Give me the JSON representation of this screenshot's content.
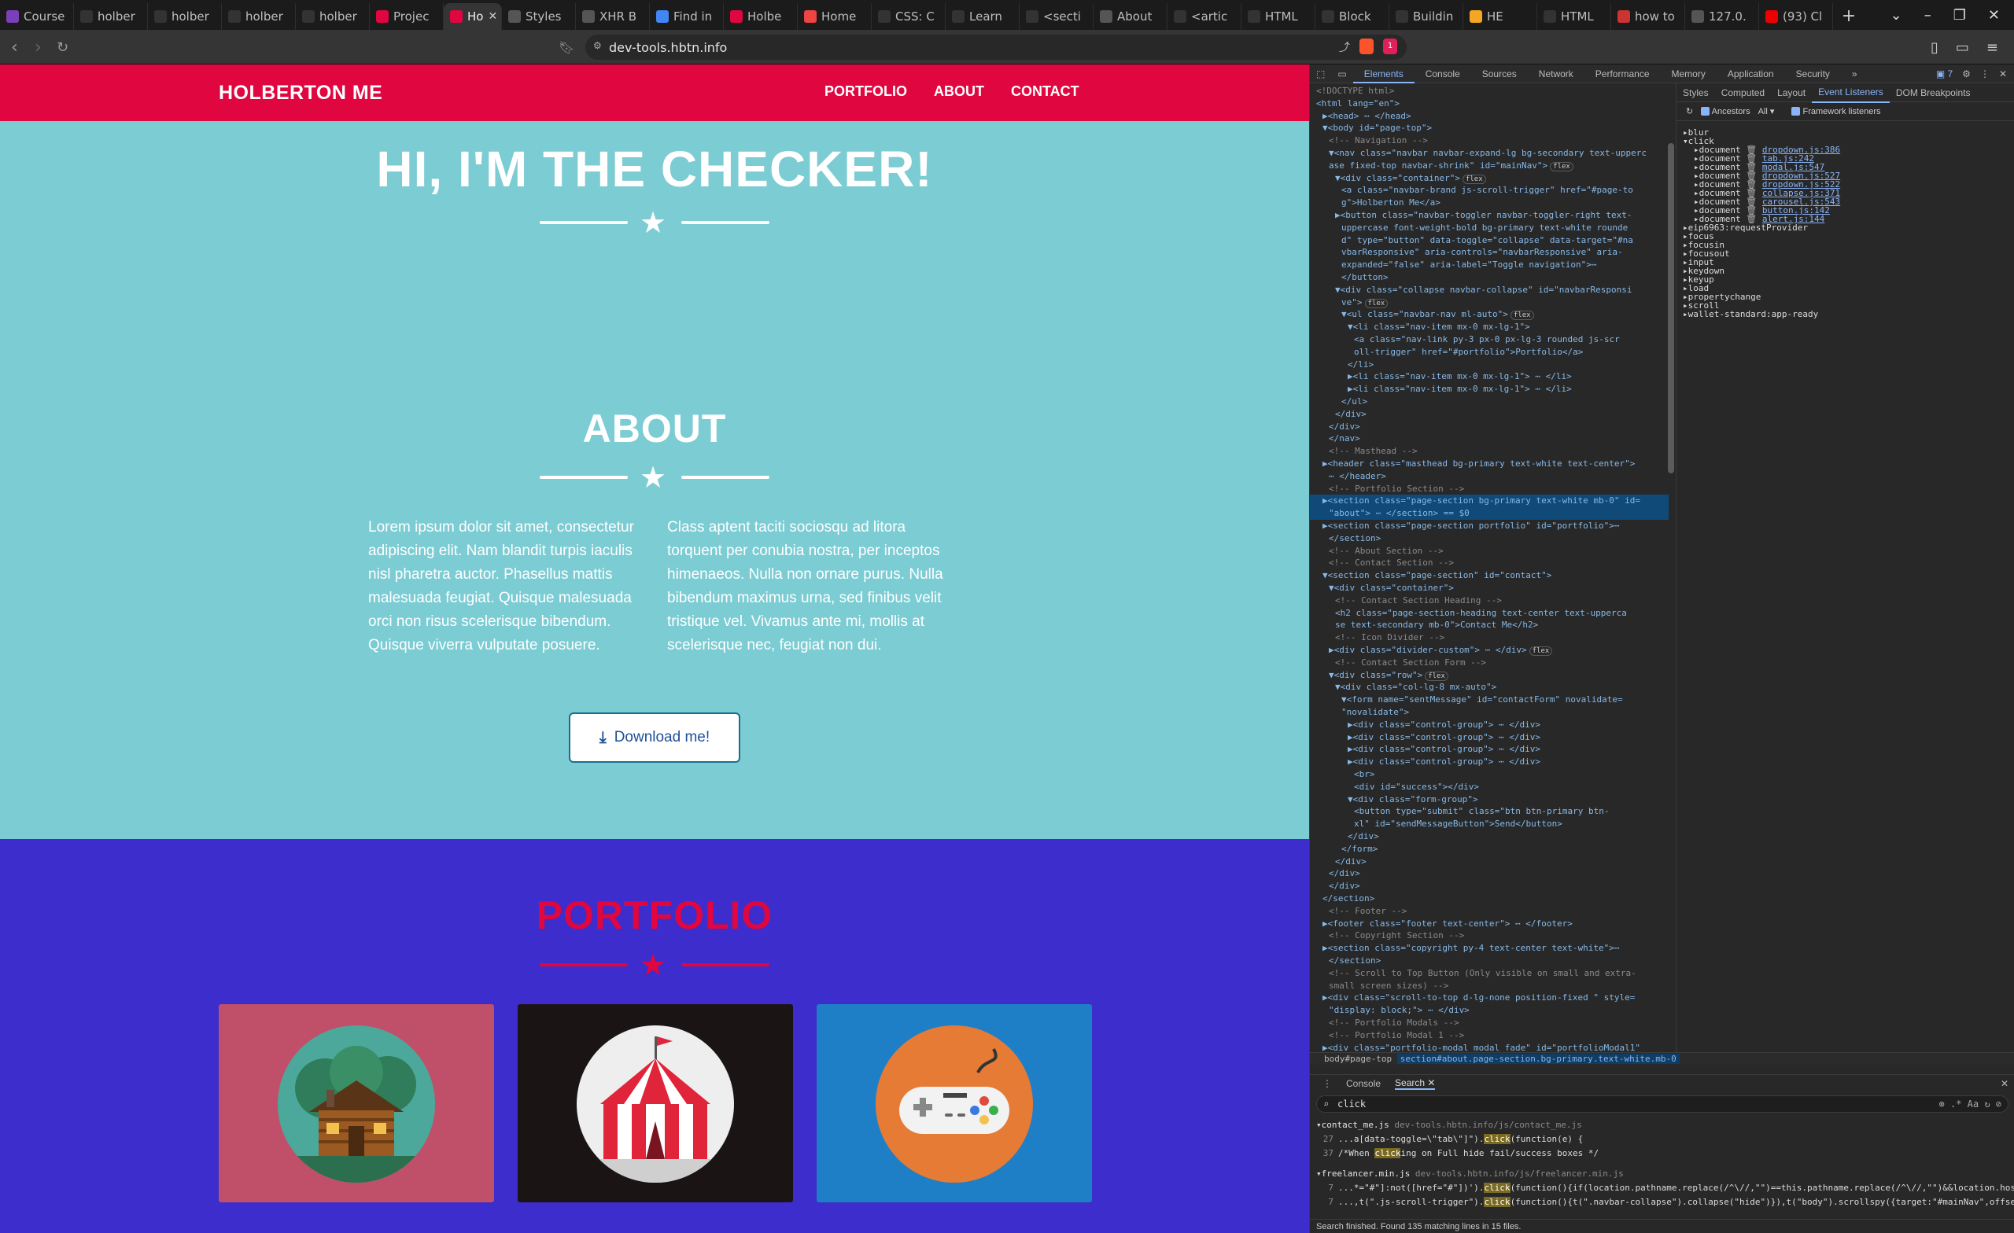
{
  "browser": {
    "tabs": [
      {
        "label": "Course",
        "color": "#7b3fb8"
      },
      {
        "label": "holber",
        "color": "#333"
      },
      {
        "label": "holber",
        "color": "#333"
      },
      {
        "label": "holber",
        "color": "#333"
      },
      {
        "label": "holber",
        "color": "#333"
      },
      {
        "label": "Projec",
        "color": "#e0063f"
      },
      {
        "label": "Ho",
        "color": "#e0063f",
        "active": true
      },
      {
        "label": "Styles",
        "color": "#555"
      },
      {
        "label": "XHR B",
        "color": "#555"
      },
      {
        "label": "Find in",
        "color": "#4285f4"
      },
      {
        "label": "Holbe",
        "color": "#e0063f"
      },
      {
        "label": "Home",
        "color": "#e44"
      },
      {
        "label": "CSS: C",
        "color": "#333"
      },
      {
        "label": "Learn",
        "color": "#333"
      },
      {
        "label": "<secti",
        "color": "#333"
      },
      {
        "label": "About",
        "color": "#555"
      },
      {
        "label": "<artic",
        "color": "#333"
      },
      {
        "label": "HTML",
        "color": "#333"
      },
      {
        "label": "Block",
        "color": "#333"
      },
      {
        "label": "Buildin",
        "color": "#333"
      },
      {
        "label": "HE",
        "color": "#f5a623"
      },
      {
        "label": "HTML",
        "color": "#333"
      },
      {
        "label": "how to",
        "color": "#c33"
      },
      {
        "label": "127.0.",
        "color": "#555"
      },
      {
        "label": "(93) Cl",
        "color": "#e00"
      }
    ],
    "url": "dev-tools.hbtn.info",
    "new_tab_icon": "plus-icon",
    "notif_count": "1"
  },
  "site": {
    "brand": "HOLBERTON ME",
    "nav": [
      "PORTFOLIO",
      "ABOUT",
      "CONTACT"
    ],
    "hero_title": "HI, I'M THE CHECKER!",
    "about_title": "ABOUT",
    "about_left": "Lorem ipsum dolor sit amet, consectetur adipiscing elit. Nam blandit turpis iaculis nisl pharetra auctor. Phasellus mattis malesuada feugiat. Quisque malesuada orci non risus scelerisque bibendum. Quisque viverra vulputate posuere.",
    "about_right": "Class aptent taciti sociosqu ad litora torquent per conubia nostra, per inceptos himenaeos. Nulla non ornare purus. Nulla bibendum maximus urna, sed finibus velit tristique vel. Vivamus ante mi, mollis at scelerisque nec, feugiat non dui.",
    "download_label": "Download me!",
    "portfolio_title": "PORTFOLIO",
    "portfolio_items": [
      {
        "name": "cabin",
        "bg": "#c0506a",
        "circle": "#4ba89a"
      },
      {
        "name": "circus",
        "bg": "#1b1414",
        "circle": "#eeeeee"
      },
      {
        "name": "game",
        "bg": "#1f7fc6",
        "circle": "#e67b35"
      }
    ],
    "colors": {
      "nav": "#e0063f",
      "about_bg": "#7cccd3",
      "portfolio_bg": "#3c2dcc",
      "accent": "#e0063f"
    }
  },
  "devtools": {
    "main_tabs": [
      "Elements",
      "Console",
      "Sources",
      "Network",
      "Performance",
      "Memory",
      "Application",
      "Security"
    ],
    "issues_count": "7",
    "side_tabs": [
      "Styles",
      "Computed",
      "Layout",
      "Event Listeners",
      "DOM Breakpoints"
    ],
    "ancestors_label": "Ancestors",
    "all_label": "All",
    "framework_label": "Framework listeners",
    "events_before": [
      "blur",
      "click"
    ],
    "click_handlers": [
      {
        "target": "document",
        "loc": "dropdown.js:386"
      },
      {
        "target": "document",
        "loc": "tab.js:242"
      },
      {
        "target": "document",
        "loc": "modal.js:547"
      },
      {
        "target": "document",
        "loc": "dropdown.js:527"
      },
      {
        "target": "document",
        "loc": "dropdown.js:522"
      },
      {
        "target": "document",
        "loc": "collapse.js:371"
      },
      {
        "target": "document",
        "loc": "carousel.js:543"
      },
      {
        "target": "document",
        "loc": "button.js:142"
      },
      {
        "target": "document",
        "loc": "alert.js:144"
      }
    ],
    "events_after": [
      "eip6963:requestProvider",
      "focus",
      "focusin",
      "focusout",
      "input",
      "keydown",
      "keyup",
      "load",
      "propertychange",
      "scroll",
      "wallet-standard:app-ready"
    ],
    "breadcrumb": [
      "body#page-top",
      "section#about.page-section.bg-primary.text-white.mb-0"
    ],
    "dom_lines": [
      {
        "i": 0,
        "h": "<!DOCTYPE html>",
        "k": "cmt"
      },
      {
        "i": 0,
        "h": "<html lang=\"en\">",
        "k": "tag"
      },
      {
        "i": 1,
        "h": "▶<head> ⋯ </head>",
        "k": "tag"
      },
      {
        "i": 1,
        "h": "▼<body id=\"page-top\">",
        "k": "tag"
      },
      {
        "i": 2,
        "h": "<!-- Navigation -->",
        "k": "cmt"
      },
      {
        "i": 2,
        "h": "▼<nav class=\"navbar navbar-expand-lg bg-secondary text-upperc",
        "k": "tag"
      },
      {
        "i": 2,
        "h": " ase fixed-top navbar-shrink\" id=\"mainNav\">",
        "k": "tag",
        "pill": "flex"
      },
      {
        "i": 3,
        "h": "▼<div class=\"container\">",
        "k": "tag",
        "pill": "flex"
      },
      {
        "i": 4,
        "h": "<a class=\"navbar-brand js-scroll-trigger\" href=\"#page-to",
        "k": "tag"
      },
      {
        "i": 4,
        "h": "g\">Holberton Me</a>",
        "k": "tag"
      },
      {
        "i": 3,
        "h": "▶<button class=\"navbar-toggler navbar-toggler-right text-",
        "k": "tag"
      },
      {
        "i": 4,
        "h": "uppercase font-weight-bold bg-primary text-white rounde",
        "k": "tag"
      },
      {
        "i": 4,
        "h": "d\" type=\"button\" data-toggle=\"collapse\" data-target=\"#na",
        "k": "tag"
      },
      {
        "i": 4,
        "h": "vbarResponsive\" aria-controls=\"navbarResponsive\" aria-",
        "k": "tag"
      },
      {
        "i": 4,
        "h": "expanded=\"false\" aria-label=\"Toggle navigation\">⋯",
        "k": "tag"
      },
      {
        "i": 4,
        "h": "</button>",
        "k": "tag"
      },
      {
        "i": 3,
        "h": "▼<div class=\"collapse navbar-collapse\" id=\"navbarResponsi",
        "k": "tag"
      },
      {
        "i": 4,
        "h": "ve\">",
        "k": "tag",
        "pill": "flex"
      },
      {
        "i": 4,
        "h": "▼<ul class=\"navbar-nav ml-auto\">",
        "k": "tag",
        "pill": "flex"
      },
      {
        "i": 5,
        "h": "▼<li class=\"nav-item mx-0 mx-lg-1\">",
        "k": "tag"
      },
      {
        "i": 6,
        "h": "<a class=\"nav-link py-3 px-0 px-lg-3 rounded js-scr",
        "k": "tag"
      },
      {
        "i": 6,
        "h": "oll-trigger\" href=\"#portfolio\">Portfolio</a>",
        "k": "tag"
      },
      {
        "i": 5,
        "h": "</li>",
        "k": "tag"
      },
      {
        "i": 5,
        "h": "▶<li class=\"nav-item mx-0 mx-lg-1\"> ⋯ </li>",
        "k": "tag"
      },
      {
        "i": 5,
        "h": "▶<li class=\"nav-item mx-0 mx-lg-1\"> ⋯ </li>",
        "k": "tag"
      },
      {
        "i": 4,
        "h": "</ul>",
        "k": "tag"
      },
      {
        "i": 3,
        "h": "</div>",
        "k": "tag"
      },
      {
        "i": 2,
        "h": "</div>",
        "k": "tag"
      },
      {
        "i": 2,
        "h": "</nav>",
        "k": "tag"
      },
      {
        "i": 2,
        "h": "<!-- Masthead -->",
        "k": "cmt"
      },
      {
        "i": 1,
        "h": "▶<header class=\"masthead bg-primary text-white text-center\">",
        "k": "tag"
      },
      {
        "i": 2,
        "h": "⋯ </header>",
        "k": "tag"
      },
      {
        "i": 2,
        "h": "<!-- Portfolio Section -->",
        "k": "cmt"
      },
      {
        "i": 1,
        "h": "▶<section class=\"page-section bg-primary text-white mb-0\" id=",
        "k": "tag",
        "sel": true
      },
      {
        "i": 2,
        "h": "\"about\"> ⋯ </section> == $0",
        "k": "tag",
        "sel": true
      },
      {
        "i": 1,
        "h": "▶<section class=\"page-section portfolio\" id=\"portfolio\">⋯",
        "k": "tag"
      },
      {
        "i": 2,
        "h": "</section>",
        "k": "tag"
      },
      {
        "i": 2,
        "h": "<!-- About Section -->",
        "k": "cmt"
      },
      {
        "i": 2,
        "h": "<!-- Contact Section -->",
        "k": "cmt"
      },
      {
        "i": 1,
        "h": "▼<section class=\"page-section\" id=\"contact\">",
        "k": "tag"
      },
      {
        "i": 2,
        "h": "▼<div class=\"container\">",
        "k": "tag"
      },
      {
        "i": 3,
        "h": "<!-- Contact Section Heading -->",
        "k": "cmt"
      },
      {
        "i": 3,
        "h": "<h2 class=\"page-section-heading text-center text-upperca",
        "k": "tag"
      },
      {
        "i": 3,
        "h": "se text-secondary mb-0\">Contact Me</h2>",
        "k": "tag"
      },
      {
        "i": 3,
        "h": "<!-- Icon Divider -->",
        "k": "cmt"
      },
      {
        "i": 2,
        "h": "▶<div class=\"divider-custom\"> ⋯ </div>",
        "k": "tag",
        "pill": "flex"
      },
      {
        "i": 3,
        "h": "<!-- Contact Section Form -->",
        "k": "cmt"
      },
      {
        "i": 2,
        "h": "▼<div class=\"row\">",
        "k": "tag",
        "pill": "flex"
      },
      {
        "i": 3,
        "h": "▼<div class=\"col-lg-8 mx-auto\">",
        "k": "tag"
      },
      {
        "i": 4,
        "h": "▼<form name=\"sentMessage\" id=\"contactForm\" novalidate=",
        "k": "tag"
      },
      {
        "i": 4,
        "h": "\"novalidate\">",
        "k": "tag"
      },
      {
        "i": 5,
        "h": "▶<div class=\"control-group\"> ⋯ </div>",
        "k": "tag"
      },
      {
        "i": 5,
        "h": "▶<div class=\"control-group\"> ⋯ </div>",
        "k": "tag"
      },
      {
        "i": 5,
        "h": "▶<div class=\"control-group\"> ⋯ </div>",
        "k": "tag"
      },
      {
        "i": 5,
        "h": "▶<div class=\"control-group\"> ⋯ </div>",
        "k": "tag"
      },
      {
        "i": 6,
        "h": "<br>",
        "k": "tag"
      },
      {
        "i": 6,
        "h": "<div id=\"success\"></div>",
        "k": "tag"
      },
      {
        "i": 5,
        "h": "▼<div class=\"form-group\">",
        "k": "tag"
      },
      {
        "i": 6,
        "h": "<button type=\"submit\" class=\"btn btn-primary btn-",
        "k": "tag"
      },
      {
        "i": 6,
        "h": "xl\" id=\"sendMessageButton\">Send</button>",
        "k": "tag"
      },
      {
        "i": 5,
        "h": "</div>",
        "k": "tag"
      },
      {
        "i": 4,
        "h": "</form>",
        "k": "tag"
      },
      {
        "i": 3,
        "h": "</div>",
        "k": "tag"
      },
      {
        "i": 2,
        "h": "</div>",
        "k": "tag"
      },
      {
        "i": 2,
        "h": "</div>",
        "k": "tag"
      },
      {
        "i": 1,
        "h": "</section>",
        "k": "tag"
      },
      {
        "i": 2,
        "h": "<!-- Footer -->",
        "k": "cmt"
      },
      {
        "i": 1,
        "h": "▶<footer class=\"footer text-center\"> ⋯ </footer>",
        "k": "tag"
      },
      {
        "i": 2,
        "h": "<!-- Copyright Section -->",
        "k": "cmt"
      },
      {
        "i": 1,
        "h": "▶<section class=\"copyright py-4 text-center text-white\">⋯",
        "k": "tag"
      },
      {
        "i": 2,
        "h": "</section>",
        "k": "tag"
      },
      {
        "i": 2,
        "h": "<!-- Scroll to Top Button (Only visible on small and extra-",
        "k": "cmt"
      },
      {
        "i": 2,
        "h": "small screen sizes) -->",
        "k": "cmt"
      },
      {
        "i": 1,
        "h": "▶<div class=\"scroll-to-top d-lg-none position-fixed \" style=",
        "k": "tag"
      },
      {
        "i": 2,
        "h": "\"display: block;\"> ⋯ </div>",
        "k": "tag"
      },
      {
        "i": 2,
        "h": "<!-- Portfolio Modals -->",
        "k": "cmt"
      },
      {
        "i": 2,
        "h": "<!-- Portfolio Modal 1 -->",
        "k": "cmt"
      },
      {
        "i": 1,
        "h": "▶<div class=\"portfolio-modal modal fade\" id=\"portfolioModal1\"",
        "k": "tag"
      }
    ],
    "drawer_tabs": [
      "Console",
      "Search"
    ],
    "search_query": "click",
    "results": [
      {
        "file": "contact_me.js",
        "path": "dev-tools.hbtn.info/js/contact_me.js",
        "lines": [
          {
            "n": "27",
            "pre": "...a[data-toggle=\\\"tab\\\"]\").",
            "hl": "click",
            "post": "(function(e) {"
          },
          {
            "n": "37",
            "pre": "/*When ",
            "hl": "click",
            "post": "ing on Full hide fail/success boxes */"
          }
        ]
      },
      {
        "file": "freelancer.min.js",
        "path": "dev-tools.hbtn.info/js/freelancer.min.js",
        "lines": [
          {
            "n": "7",
            "pre": "...*=\"#\"]:not([href=\"#\"])').",
            "hl": "click",
            "post": "(function(){if(location.pathname.replace(/^\\//,\"\")==this.pathname.replace(/^\\//,\"\")&&location.hostname==this.hostname){v..."
          },
          {
            "n": "7",
            "pre": "...,t(\".js-scroll-trigger\").",
            "hl": "click",
            "post": "(function(){t(\".navbar-collapse\").collapse(\"hide\")}),t(\"body\").scrollspy({target:\"#mainNav\",offset:80});function o(){100<t(\"#mai..."
          }
        ]
      }
    ],
    "search_status": "Search finished.  Found 135 matching lines in 15 files."
  }
}
